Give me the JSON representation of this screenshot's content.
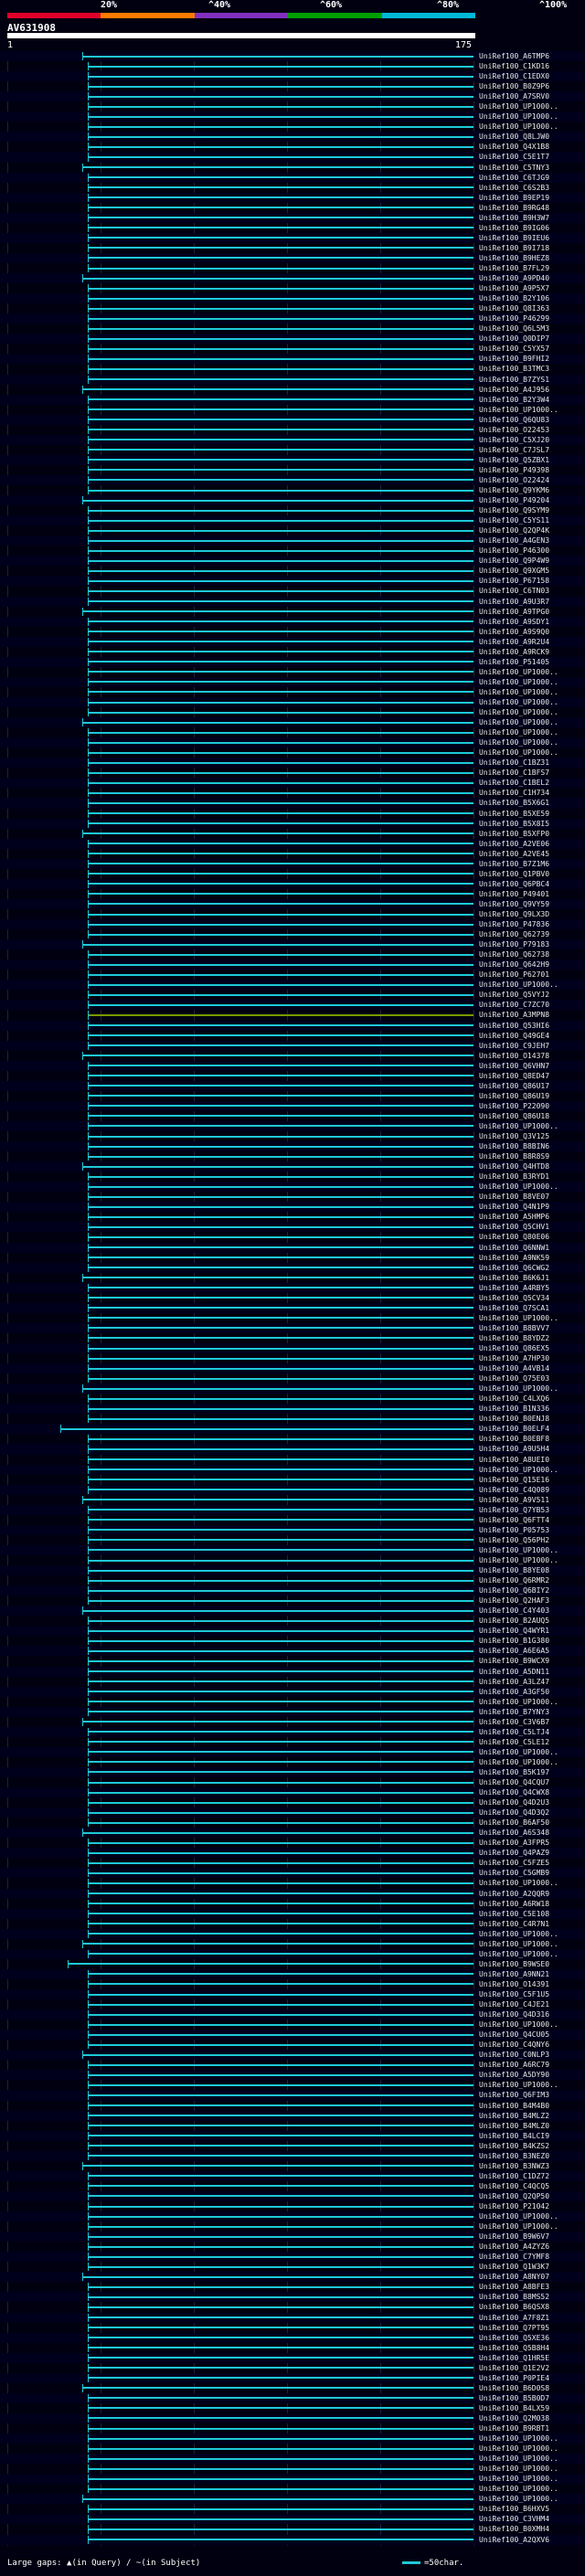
{
  "scale": {
    "labels": [
      "20%",
      "^40%",
      "^60%",
      "^80%",
      "^100%"
    ],
    "colors": [
      "#e0002a",
      "#ff7a00",
      "#8030c0",
      "#00a000",
      "#00b8d8"
    ]
  },
  "query": {
    "id": "AV631908",
    "start": "1",
    "end": "175"
  },
  "hits": [
    "UniRef100_A6TMP6",
    "UniRef100_C1KD16",
    "UniRef100_C1EDX0",
    "UniRef100_B0Z9P6",
    "UniRef100_A7SRV0",
    "UniRef100_UP1000..",
    "UniRef100_UP1000..",
    "UniRef100_UP1000..",
    "UniRef100_Q8LJW0",
    "UniRef100_Q4X1B8",
    "UniRef100_C5E1T7",
    "UniRef100_C5TNY3",
    "UniRef100_C6TJG9",
    "UniRef100_C6S2B3",
    "UniRef100_B9EP19",
    "UniRef100_B9RG48",
    "UniRef100_B9H3W7",
    "UniRef100_B9IG06",
    "UniRef100_B9IEU6",
    "UniRef100_B9I718",
    "UniRef100_B9HEZ8",
    "UniRef100_B7FL29",
    "UniRef100_A9PD40",
    "UniRef100_A9P5X7",
    "UniRef100_B2Y106",
    "UniRef100_Q8I363",
    "UniRef100_P46299",
    "UniRef100_Q6L5M3",
    "UniRef100_Q0DIP7",
    "UniRef100_C5YX57",
    "UniRef100_B9FHI2",
    "UniRef100_B3TMC3",
    "UniRef100_B7ZYS1",
    "UniRef100_A4J956",
    "UniRef100_B2Y3W4",
    "UniRef100_UP1000..",
    "UniRef100_Q6QU83",
    "UniRef100_O22453",
    "UniRef100_C5XJ20",
    "UniRef100_C7JSL7",
    "UniRef100_Q5ZBX1",
    "UniRef100_P49398",
    "UniRef100_O22424",
    "UniRef100_Q9YKM6",
    "UniRef100_P49204",
    "UniRef100_Q9SYM9",
    "UniRef100_C5YS11",
    "UniRef100_Q2QP4K",
    "UniRef100_A4GEN3",
    "UniRef100_P46300",
    "UniRef100_Q9P4W9",
    "UniRef100_Q9XGM5",
    "UniRef100_P67158",
    "UniRef100_C6TN03",
    "UniRef100_A9U3R7",
    "UniRef100_A9TPG0",
    "UniRef100_A9SDY1",
    "UniRef100_A9S9Q0",
    "UniRef100_A9R2U4",
    "UniRef100_A9RCK9",
    "UniRef100_P51405",
    "UniRef100_UP1000..",
    "UniRef100_UP1000..",
    "UniRef100_UP1000..",
    "UniRef100_UP1000..",
    "UniRef100_UP1000..",
    "UniRef100_UP1000..",
    "UniRef100_UP1000..",
    "UniRef100_UP1000..",
    "UniRef100_UP1000..",
    "UniRef100_C1BZ31",
    "UniRef100_C1BFS7",
    "UniRef100_C1BEL2",
    "UniRef100_C1H734",
    "UniRef100_B5X6G1",
    "UniRef100_B5XE59",
    "UniRef100_B5X8I5",
    "UniRef100_B5XFP0",
    "UniRef100_A2VE06",
    "UniRef100_A2VE45",
    "UniRef100_B7Z1M6",
    "UniRef100_Q1PBV0",
    "UniRef100_Q6PBC4",
    "UniRef100_P49401",
    "UniRef100_Q9VY59",
    "UniRef100_Q9LX3D",
    "UniRef100_P47836",
    "UniRef100_Q62739",
    "UniRef100_P79183",
    "UniRef100_Q62738",
    "UniRef100_Q642H9",
    "UniRef100_P62701",
    "UniRef100_UP1000..",
    "UniRef100_Q5VYJ2",
    "UniRef100_C7ZC70",
    "UniRef100_A3MPN8",
    "UniRef100_Q53HI6",
    "UniRef100_Q49GE4",
    "UniRef100_C9JEH7",
    "UniRef100_O14378",
    "UniRef100_Q6VHN7",
    "UniRef100_Q8ED47",
    "UniRef100_Q86U17",
    "UniRef100_Q86U19",
    "UniRef100_P22090",
    "UniRef100_Q86U18",
    "UniRef100_UP1000..",
    "UniRef100_Q3V125",
    "UniRef100_B8BIN6",
    "UniRef100_B8R8S9",
    "UniRef100_Q4HTD8",
    "UniRef100_B3RYD1",
    "UniRef100_UP1000..",
    "UniRef100_B8VE07",
    "UniRef100_Q4N1P9",
    "UniRef100_A5HMP6",
    "UniRef100_Q5CHV1",
    "UniRef100_Q80E06",
    "UniRef100_Q6NNW1",
    "UniRef100_A9NK59",
    "UniRef100_Q6CWG2",
    "UniRef100_B6K6J1",
    "UniRef100_A4RBY5",
    "UniRef100_Q5CV34",
    "UniRef100_Q7SCA1",
    "UniRef100_UP1000..",
    "UniRef100_B8BVV7",
    "UniRef100_B8YDZ2",
    "UniRef100_Q86EX5",
    "UniRef100_A7HP30",
    "UniRef100_A4VB14",
    "UniRef100_Q75E03",
    "UniRef100_UP1000..",
    "UniRef100_C4LXQ6",
    "UniRef100_B1N336",
    "UniRef100_B0ENJ8",
    "UniRef100_B0ELF4",
    "UniRef100_B0EBF8",
    "UniRef100_A9U5H4",
    "UniRef100_A8UEI0",
    "UniRef100_UP1000..",
    "UniRef100_Q15E16",
    "UniRef100_C4Q089",
    "UniRef100_A9V511",
    "UniRef100_Q7YB53",
    "UniRef100_Q6FTT4",
    "UniRef100_P05753",
    "UniRef100_Q56PH2",
    "UniRef100_UP1000..",
    "UniRef100_UP1000..",
    "UniRef100_B8YE08",
    "UniRef100_Q6RMR2",
    "UniRef100_Q6BIY2",
    "UniRef100_Q2HAF3",
    "UniRef100_C4Y403",
    "UniRef100_B2AUQ5",
    "UniRef100_Q4WYR1",
    "UniRef100_B1G380",
    "UniRef100_A6E6A5",
    "UniRef100_B9WCX9",
    "UniRef100_A5DN11",
    "UniRef100_A3LZ47",
    "UniRef100_A3GF50",
    "UniRef100_UP1000..",
    "UniRef100_B7YNY3",
    "UniRef100_C3V6B7",
    "UniRef100_C5LTJ4",
    "UniRef100_C5LE12",
    "UniRef100_UP1000..",
    "UniRef100_UP1000..",
    "UniRef100_B5K197",
    "UniRef100_Q4CQU7",
    "UniRef100_Q4CWX8",
    "UniRef100_Q4D2U3",
    "UniRef100_Q4D3Q2",
    "UniRef100_B6AF50",
    "UniRef100_A6S348",
    "UniRef100_A3FPR5",
    "UniRef100_Q4PAZ9",
    "UniRef100_C5FZE5",
    "UniRef100_C5GMB9",
    "UniRef100_UP1000..",
    "UniRef100_A2QQR9",
    "UniRef100_A6RW18",
    "UniRef100_C5E108",
    "UniRef100_C4R7N1",
    "UniRef100_UP1000..",
    "UniRef100_UP1000..",
    "UniRef100_UP1000..",
    "UniRef100_B9WSE0",
    "UniRef100_A9NN21",
    "UniRef100_O14391",
    "UniRef100_C5F1U5",
    "UniRef100_C4JE21",
    "UniRef100_Q4D316",
    "UniRef100_UP1000..",
    "UniRef100_Q4CU05",
    "UniRef100_C4QNY6",
    "UniRef100_C0NLP3",
    "UniRef100_A6RC79",
    "UniRef100_A5DY90",
    "UniRef100_UP1000..",
    "UniRef100_Q6FIM3",
    "UniRef100_B4M4B0",
    "UniRef100_B4MLZ2",
    "UniRef100_B4MLZ0",
    "UniRef100_B4LCI9",
    "UniRef100_B4KZS2",
    "UniRef100_B3NEZ0",
    "UniRef100_B3NWZ3",
    "UniRef100_C1DZ72",
    "UniRef100_C4QCQ5",
    "UniRef100_Q2QP50",
    "UniRef100_P21042",
    "UniRef100_UP1000..",
    "UniRef100_UP1000..",
    "UniRef100_B9W6V7",
    "UniRef100_A4ZYZ6",
    "UniRef100_C7YMF8",
    "UniRef100_Q1W3K7",
    "UniRef100_A8NY07",
    "UniRef100_A8BFE3",
    "UniRef100_B8MS52",
    "UniRef100_B6QSX8",
    "UniRef100_A7F8Z1",
    "UniRef100_Q7PT95",
    "UniRef100_Q5XE36",
    "UniRef100_Q5B8H4",
    "UniRef100_Q1HR5E",
    "UniRef100_Q1E2V2",
    "UniRef100_P0PIE4",
    "UniRef100_B6D0S8",
    "UniRef100_B5B0D7",
    "UniRef100_B4LX59",
    "UniRef100_Q2M038",
    "UniRef100_B9RBT1",
    "UniRef100_UP1000..",
    "UniRef100_UP1000..",
    "UniRef100_UP1000..",
    "UniRef100_UP1000..",
    "UniRef100_UP1000..",
    "UniRef100_UP1000..",
    "UniRef100_UP1000..",
    "UniRef100_B6HXV5",
    "UniRef100_C3VHM4",
    "UniRef100_B0XMH4",
    "UniRef100_A2QXV6"
  ],
  "footer": {
    "large_gaps_label": "Large gaps:",
    "in_query": "(in Query)",
    "in_subject": "(in Subject)",
    "legend_label": "=50char."
  }
}
